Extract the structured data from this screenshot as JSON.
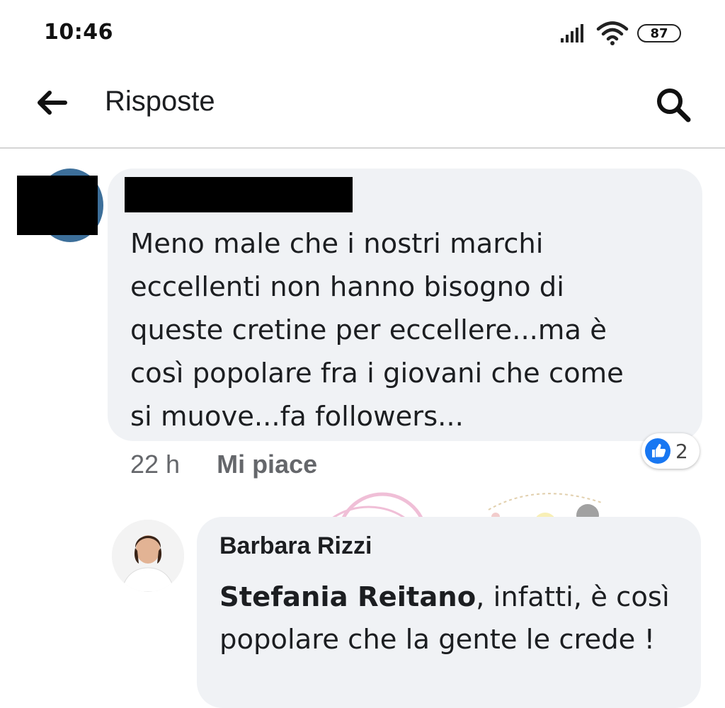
{
  "status_bar": {
    "time": "10:46",
    "battery_level": "87",
    "icons": [
      "signal-icon",
      "wifi-icon",
      "battery-icon"
    ]
  },
  "header": {
    "title": "Risposte",
    "back_icon": "arrow-left-icon",
    "search_icon": "search-icon"
  },
  "comment": {
    "author": "",
    "text": "Meno male che i nostri marchi\neccellenti non hanno bisogno di\nqueste cretine per eccellere...ma è\ncosì popolare fra i giovani che come\nsi muove...fa followers...",
    "time": "22 h",
    "like_label": "Mi piace",
    "reaction_count": "2",
    "reaction_icon": "thumbs-up-icon",
    "accent": "#1877f2"
  },
  "reply": {
    "author": "Barbara Rizzi",
    "mention": "Stefania Reitano",
    "text": ", infatti, è così popolare che la gente le crede !"
  }
}
